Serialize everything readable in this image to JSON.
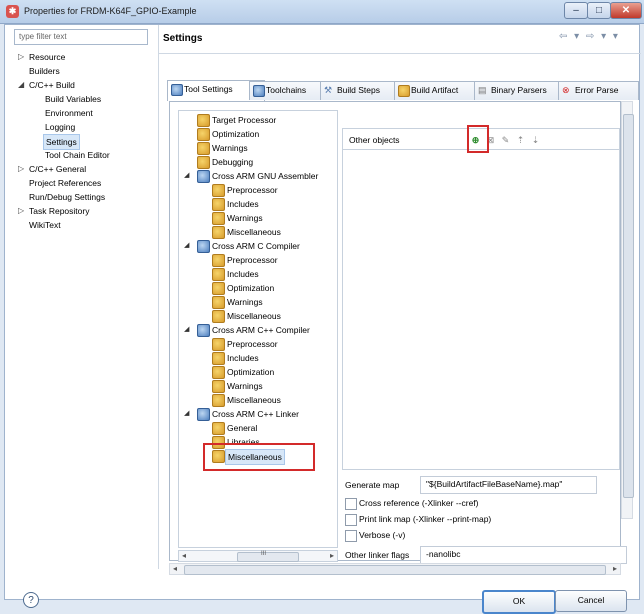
{
  "window": {
    "title": "Properties for FRDM-K64F_GPIO-Example",
    "buttons": {
      "minimize": "–",
      "maximize": "□",
      "close": "✕"
    }
  },
  "filter": {
    "placeholder": "type filter text"
  },
  "left_tree": {
    "items": [
      {
        "label": "Resource",
        "level": 1,
        "arrow": "▷"
      },
      {
        "label": "Builders",
        "level": 1,
        "arrow": ""
      },
      {
        "label": "C/C++ Build",
        "level": 1,
        "arrow": "◢"
      },
      {
        "label": "Build Variables",
        "level": 2,
        "arrow": ""
      },
      {
        "label": "Environment",
        "level": 2,
        "arrow": ""
      },
      {
        "label": "Logging",
        "level": 2,
        "arrow": ""
      },
      {
        "label": "Settings",
        "level": 2,
        "arrow": "",
        "selected": true
      },
      {
        "label": "Tool Chain Editor",
        "level": 2,
        "arrow": ""
      },
      {
        "label": "C/C++ General",
        "level": 1,
        "arrow": "▷"
      },
      {
        "label": "Project References",
        "level": 1,
        "arrow": ""
      },
      {
        "label": "Run/Debug Settings",
        "level": 1,
        "arrow": ""
      },
      {
        "label": "Task Repository",
        "level": 1,
        "arrow": "▷"
      },
      {
        "label": "WikiText",
        "level": 1,
        "arrow": ""
      }
    ]
  },
  "header": {
    "title": "Settings",
    "nav": "⇦ ▾ ⇨ ▾ ▾"
  },
  "tabs": [
    {
      "label": "Tool Settings",
      "active": true
    },
    {
      "label": "Toolchains"
    },
    {
      "label": "Build Steps"
    },
    {
      "label": "Build Artifact"
    },
    {
      "label": "Binary Parsers"
    },
    {
      "label": "Error Parse"
    }
  ],
  "tool_tree": {
    "items": [
      {
        "label": "Target Processor",
        "level": 1,
        "icon": "gear"
      },
      {
        "label": "Optimization",
        "level": 1,
        "icon": "gear"
      },
      {
        "label": "Warnings",
        "level": 1,
        "icon": "gear"
      },
      {
        "label": "Debugging",
        "level": 1,
        "icon": "gear"
      },
      {
        "label": "Cross ARM GNU Assembler",
        "level": 0,
        "icon": "tool",
        "expander": "◢"
      },
      {
        "label": "Preprocessor",
        "level": 2,
        "icon": "gear"
      },
      {
        "label": "Includes",
        "level": 2,
        "icon": "gear"
      },
      {
        "label": "Warnings",
        "level": 2,
        "icon": "gear"
      },
      {
        "label": "Miscellaneous",
        "level": 2,
        "icon": "gear"
      },
      {
        "label": "Cross ARM C Compiler",
        "level": 0,
        "icon": "tool",
        "expander": "◢"
      },
      {
        "label": "Preprocessor",
        "level": 2,
        "icon": "gear"
      },
      {
        "label": "Includes",
        "level": 2,
        "icon": "gear"
      },
      {
        "label": "Optimization",
        "level": 2,
        "icon": "gear"
      },
      {
        "label": "Warnings",
        "level": 2,
        "icon": "gear"
      },
      {
        "label": "Miscellaneous",
        "level": 2,
        "icon": "gear"
      },
      {
        "label": "Cross ARM C++ Compiler",
        "level": 0,
        "icon": "tool",
        "expander": "◢"
      },
      {
        "label": "Preprocessor",
        "level": 2,
        "icon": "gear"
      },
      {
        "label": "Includes",
        "level": 2,
        "icon": "gear"
      },
      {
        "label": "Optimization",
        "level": 2,
        "icon": "gear"
      },
      {
        "label": "Warnings",
        "level": 2,
        "icon": "gear"
      },
      {
        "label": "Miscellaneous",
        "level": 2,
        "icon": "gear"
      },
      {
        "label": "Cross ARM C++ Linker",
        "level": 0,
        "icon": "tool",
        "expander": "◢"
      },
      {
        "label": "General",
        "level": 2,
        "icon": "gear"
      },
      {
        "label": "Libraries",
        "level": 2,
        "icon": "gear"
      },
      {
        "label": "Miscellaneous",
        "level": 2,
        "icon": "gear",
        "selected": true
      }
    ]
  },
  "other_objects": {
    "label": "Other objects",
    "toolbar": [
      "add-icon",
      "delete-icon",
      "edit-icon",
      "move-up-icon",
      "move-down-icon"
    ]
  },
  "options": {
    "generate_map_label": "Generate map",
    "generate_map_value": "\"${BuildArtifactFileBaseName}.map\"",
    "cross_reference": "Cross reference (-Xlinker --cref)",
    "print_link_map": "Print link map (-Xlinker --print-map)",
    "verbose": "Verbose (-v)",
    "other_flags_label": "Other linker flags",
    "other_flags_value": "-nanolibc"
  },
  "scroll": {
    "thumb_label": "III"
  },
  "footer": {
    "help": "?",
    "ok": "OK",
    "cancel": "Cancel"
  },
  "colors": {
    "highlight_red": "#d32a2a",
    "selection_blue": "#d7e7f8"
  }
}
